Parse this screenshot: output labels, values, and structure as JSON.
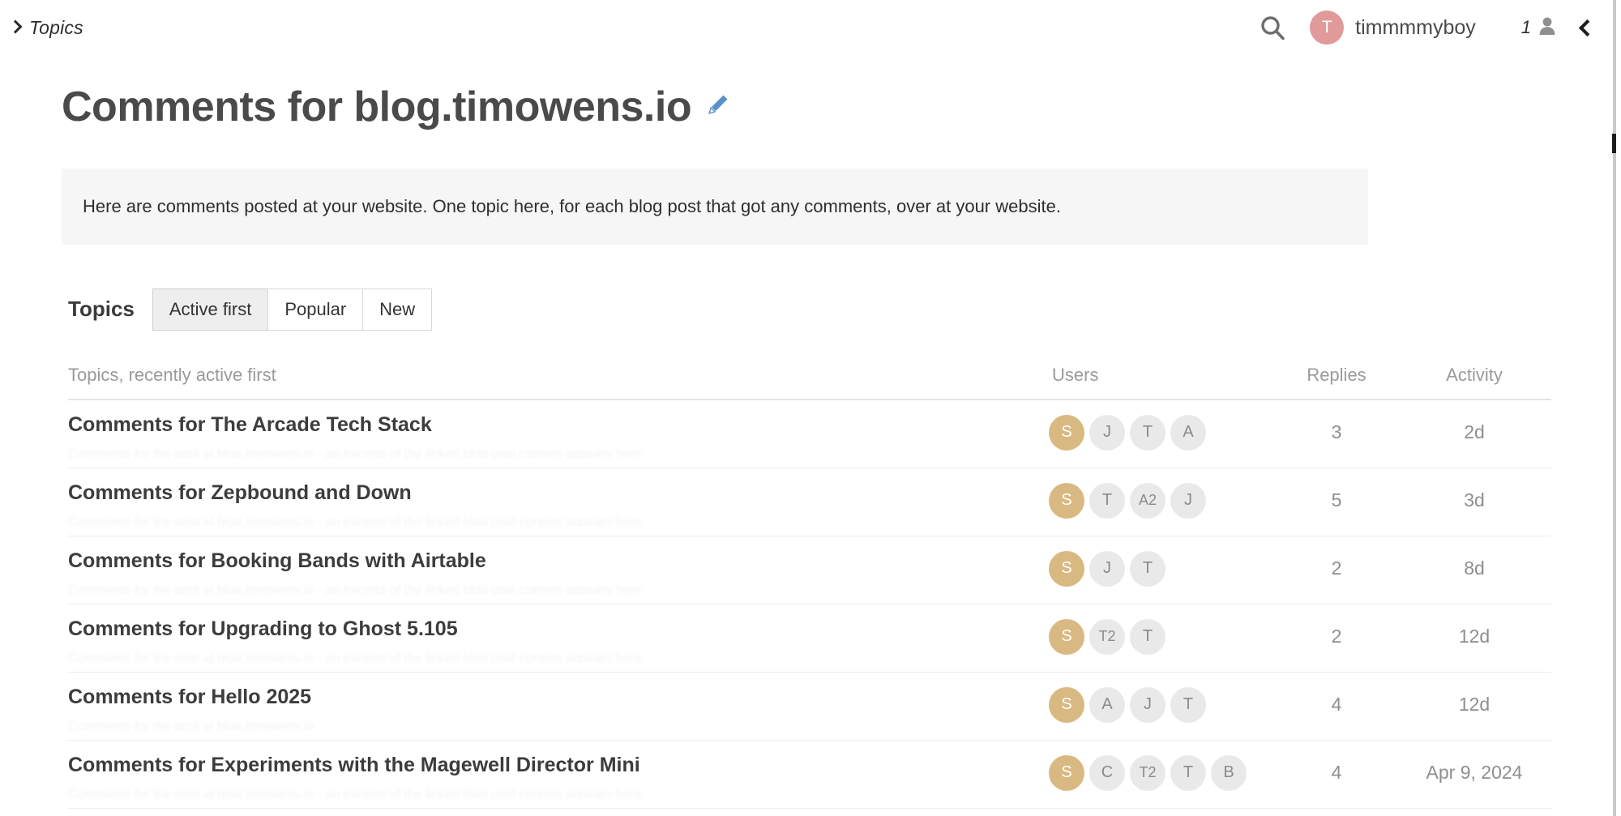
{
  "topbar": {
    "breadcrumb": "Topics",
    "breadcrumb_icon": "chevron-right-icon",
    "search_icon": "search-icon",
    "avatar_letter": "T",
    "avatar_color": "#e09a9a",
    "username": "timmmmyboy",
    "notification_count": "1",
    "notification_icon": "user-icon",
    "collapse_icon": "chevron-left-icon"
  },
  "page": {
    "title": "Comments for blog.timowens.io",
    "edit_icon": "pencil-icon",
    "edit_icon_color": "#5b8fc9",
    "banner": "Here are comments posted at your website. One topic here, for each blog post that got any comments, over at your website."
  },
  "filters": {
    "label": "Topics",
    "options": [
      {
        "label": "Active first",
        "active": true
      },
      {
        "label": "Popular",
        "active": false
      },
      {
        "label": "New",
        "active": false
      }
    ]
  },
  "table": {
    "headers": {
      "topics": "Topics, recently active first",
      "users": "Users",
      "replies": "Replies",
      "activity": "Activity"
    },
    "rows": [
      {
        "title": "Comments for The Arcade Tech Stack",
        "excerpt": "Comments for the post at blog.timowens.io  ·  an excerpt of the linked blog post content appears here",
        "users": [
          {
            "initials": "S",
            "primary": true
          },
          {
            "initials": "J",
            "primary": false
          },
          {
            "initials": "T",
            "primary": false
          },
          {
            "initials": "A",
            "primary": false
          }
        ],
        "replies": "3",
        "activity": "2d"
      },
      {
        "title": "Comments for Zepbound and Down",
        "excerpt": "Comments for the post at blog.timowens.io  ·  an excerpt of the linked blog post content appears here",
        "users": [
          {
            "initials": "S",
            "primary": true
          },
          {
            "initials": "T",
            "primary": false
          },
          {
            "initials": "A2",
            "primary": false
          },
          {
            "initials": "J",
            "primary": false
          }
        ],
        "replies": "5",
        "activity": "3d"
      },
      {
        "title": "Comments for Booking Bands with Airtable",
        "excerpt": "Comments for the post at blog.timowens.io  ·  an excerpt of the linked blog post content appears here",
        "users": [
          {
            "initials": "S",
            "primary": true
          },
          {
            "initials": "J",
            "primary": false
          },
          {
            "initials": "T",
            "primary": false
          }
        ],
        "replies": "2",
        "activity": "8d"
      },
      {
        "title": "Comments for Upgrading to Ghost 5.105",
        "excerpt": "Comments for the post at blog.timowens.io  ·  an excerpt of the linked blog post content appears here",
        "users": [
          {
            "initials": "S",
            "primary": true
          },
          {
            "initials": "T2",
            "primary": false
          },
          {
            "initials": "T",
            "primary": false
          }
        ],
        "replies": "2",
        "activity": "12d"
      },
      {
        "title": "Comments for Hello 2025",
        "excerpt": "Comments for the post at blog.timowens.io",
        "users": [
          {
            "initials": "S",
            "primary": true
          },
          {
            "initials": "A",
            "primary": false
          },
          {
            "initials": "J",
            "primary": false
          },
          {
            "initials": "T",
            "primary": false
          }
        ],
        "replies": "4",
        "activity": "12d"
      },
      {
        "title": "Comments for Experiments with the Magewell Director Mini",
        "excerpt": "Comments for the post at blog.timowens.io  ·  an excerpt of the linked blog post content appears here",
        "users": [
          {
            "initials": "S",
            "primary": true
          },
          {
            "initials": "C",
            "primary": false
          },
          {
            "initials": "T2",
            "primary": false
          },
          {
            "initials": "T",
            "primary": false
          },
          {
            "initials": "B",
            "primary": false
          }
        ],
        "replies": "4",
        "activity": "Apr 9, 2024"
      }
    ]
  }
}
